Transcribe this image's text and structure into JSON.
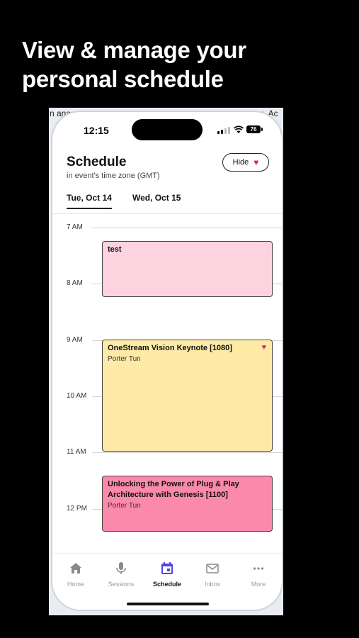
{
  "headline": {
    "line1": "View & manage your",
    "line2": "personal schedule"
  },
  "background_text": {
    "left": "n ana",
    "right": "g, Ac"
  },
  "status_bar": {
    "time": "12:15",
    "battery": "76"
  },
  "header": {
    "title": "Schedule",
    "subtitle": "in event's time zone (GMT)",
    "hide_label": "Hide",
    "heart_icon": "heart-icon"
  },
  "tabs": [
    {
      "label": "Tue, Oct 14",
      "active": true
    },
    {
      "label": "Wed, Oct 15",
      "active": false
    }
  ],
  "hours": [
    "7 AM",
    "8 AM",
    "9 AM",
    "10 AM",
    "11 AM",
    "12 PM"
  ],
  "events": [
    {
      "title": "test",
      "subtitle": "",
      "color": "#fdd3e0",
      "favorite": false
    },
    {
      "title": "OneStream Vision Keynote [1080]",
      "subtitle": "Porter Tun",
      "color": "#fdeaa6",
      "favorite": true
    },
    {
      "title": "Unlocking the Power of Plug & Play Architecture with Genesis [1100]",
      "subtitle": "Porter Tun",
      "color": "#fb89ab",
      "favorite": false
    }
  ],
  "nav": [
    {
      "label": "Home",
      "icon": "home-icon",
      "active": false
    },
    {
      "label": "Sessions",
      "icon": "microphone-icon",
      "active": false
    },
    {
      "label": "Schedule",
      "icon": "calendar-icon",
      "active": true
    },
    {
      "label": "Inbox",
      "icon": "mail-icon",
      "active": false
    },
    {
      "label": "More",
      "icon": "more-icon",
      "active": false
    }
  ],
  "colors": {
    "accent": "#4f46e5",
    "heart": "#e0245e"
  }
}
